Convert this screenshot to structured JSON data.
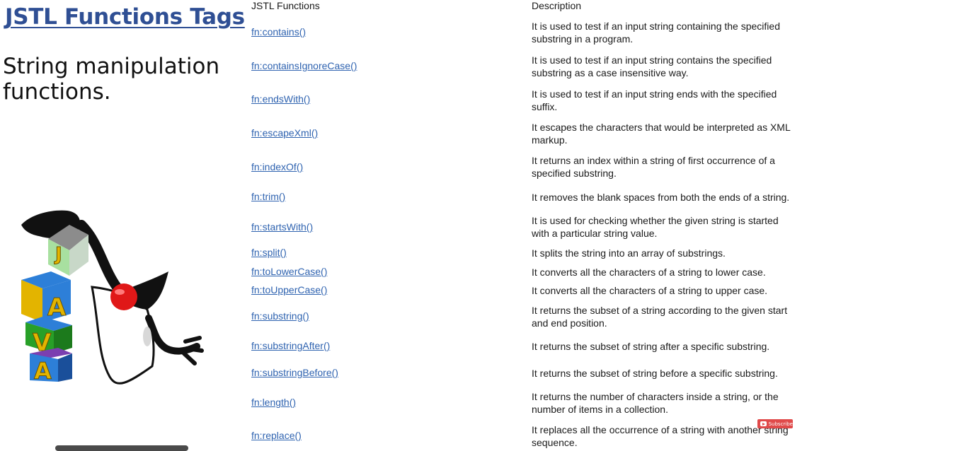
{
  "header": {
    "title": "JSTL Functions Tags",
    "subtitle": "String manipulation functions."
  },
  "table": {
    "col_function": "JSTL Functions",
    "col_description": "Description",
    "rows": [
      {
        "fn": "fn:contains()",
        "desc": "It is used to test if an input string containing the specified substring in a program."
      },
      {
        "fn": "fn:containsIgnoreCase()",
        "desc": "It is used to test if an input string contains the specified substring as a case insensitive way."
      },
      {
        "fn": "fn:endsWith()",
        "desc": "It is used to test if an input string ends with the specified suffix."
      },
      {
        "fn": "fn:escapeXml()",
        "desc": "It escapes the characters that would be interpreted as XML markup."
      },
      {
        "fn": "fn:indexOf()",
        "desc": "It returns an index within a string of first occurrence of a specified substring."
      },
      {
        "fn": "fn:trim()",
        "desc": "It removes the blank spaces from both the ends of a string."
      },
      {
        "fn": "fn:startsWith()",
        "desc": "It is used for checking whether the given string is started with a particular string value."
      },
      {
        "fn": "fn:split()",
        "desc": "It splits the string into an array of substrings."
      },
      {
        "fn": "fn:toLowerCase()",
        "desc": "It converts all the characters of a string to lower case."
      },
      {
        "fn": "fn:toUpperCase()",
        "desc": "It converts all the characters of a string to upper case."
      },
      {
        "fn": "fn:substring()",
        "desc": "It returns the subset of a string according to the given start and end position."
      },
      {
        "fn": "fn:substringAfter()",
        "desc": "It returns the subset of string after a specific substring."
      },
      {
        "fn": "fn:substringBefore()",
        "desc": "It returns the subset of string before a specific substring."
      },
      {
        "fn": "fn:length()",
        "desc": "It returns the number of characters inside a string, or the number of items in a collection."
      },
      {
        "fn": "fn:replace()",
        "desc": "It replaces all the occurrence of a string with another string sequence."
      }
    ]
  },
  "badge": {
    "label": "Subscribe",
    "icon": "youtube-icon",
    "color": "#e04a4a"
  },
  "mascot": {
    "blocks": [
      "J",
      "A",
      "V",
      "A"
    ]
  },
  "colors": {
    "title": "#2f4f94",
    "link": "#2f63b0"
  }
}
